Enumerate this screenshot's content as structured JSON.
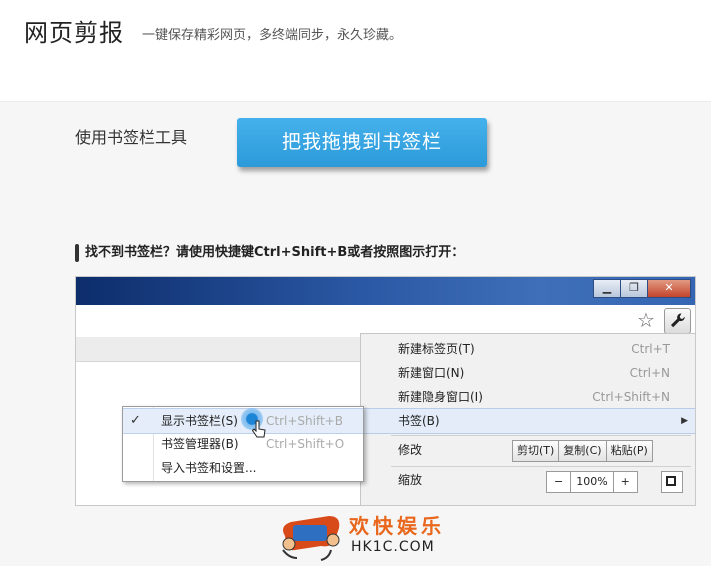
{
  "header": {
    "title": "网页剪报",
    "tagline": "一键保存精彩网页，多终端同步，永久珍藏。"
  },
  "bookmark_tool": {
    "label": "使用书签栏工具",
    "drag_button": "把我拖拽到书签栏"
  },
  "hint": "找不到书签栏？请使用快捷键Ctrl+Shift+B或者按照图示打开：",
  "browser": {
    "window_buttons": {
      "minimize": "▁",
      "maximize": "❐",
      "close": "✕"
    },
    "icons": {
      "star": "star-icon",
      "wrench": "wrench-icon"
    },
    "menu": [
      {
        "label": "新建标签页(T)",
        "shortcut": "Ctrl+T"
      },
      {
        "label": "新建窗口(N)",
        "shortcut": "Ctrl+N"
      },
      {
        "label": "新建隐身窗口(I)",
        "shortcut": "Ctrl+Shift+N"
      },
      {
        "label": "书签(B)",
        "shortcut": ""
      }
    ],
    "bookmark_arrow": "▶",
    "edit": {
      "label": "修改",
      "cut": "剪切(T)",
      "copy": "复制(C)",
      "paste": "粘贴(P)"
    },
    "zoom": {
      "label": "缩放",
      "minus": "−",
      "value": "100%",
      "plus": "+"
    },
    "submenu": [
      {
        "label": "显示书签栏(S)",
        "shortcut": "Ctrl+Shift+B",
        "checked": "✓"
      },
      {
        "label": "书签管理器(B)",
        "shortcut": "Ctrl+Shift+O"
      },
      {
        "label": "导入书签和设置...",
        "shortcut": ""
      }
    ]
  },
  "watermark": {
    "name": "欢快娱乐",
    "site": "HK1C.COM"
  },
  "colors": {
    "button_blue": "#2c9ad9",
    "watermark_orange": "#e8671c",
    "titlebar_blue": "#2a57a3"
  }
}
